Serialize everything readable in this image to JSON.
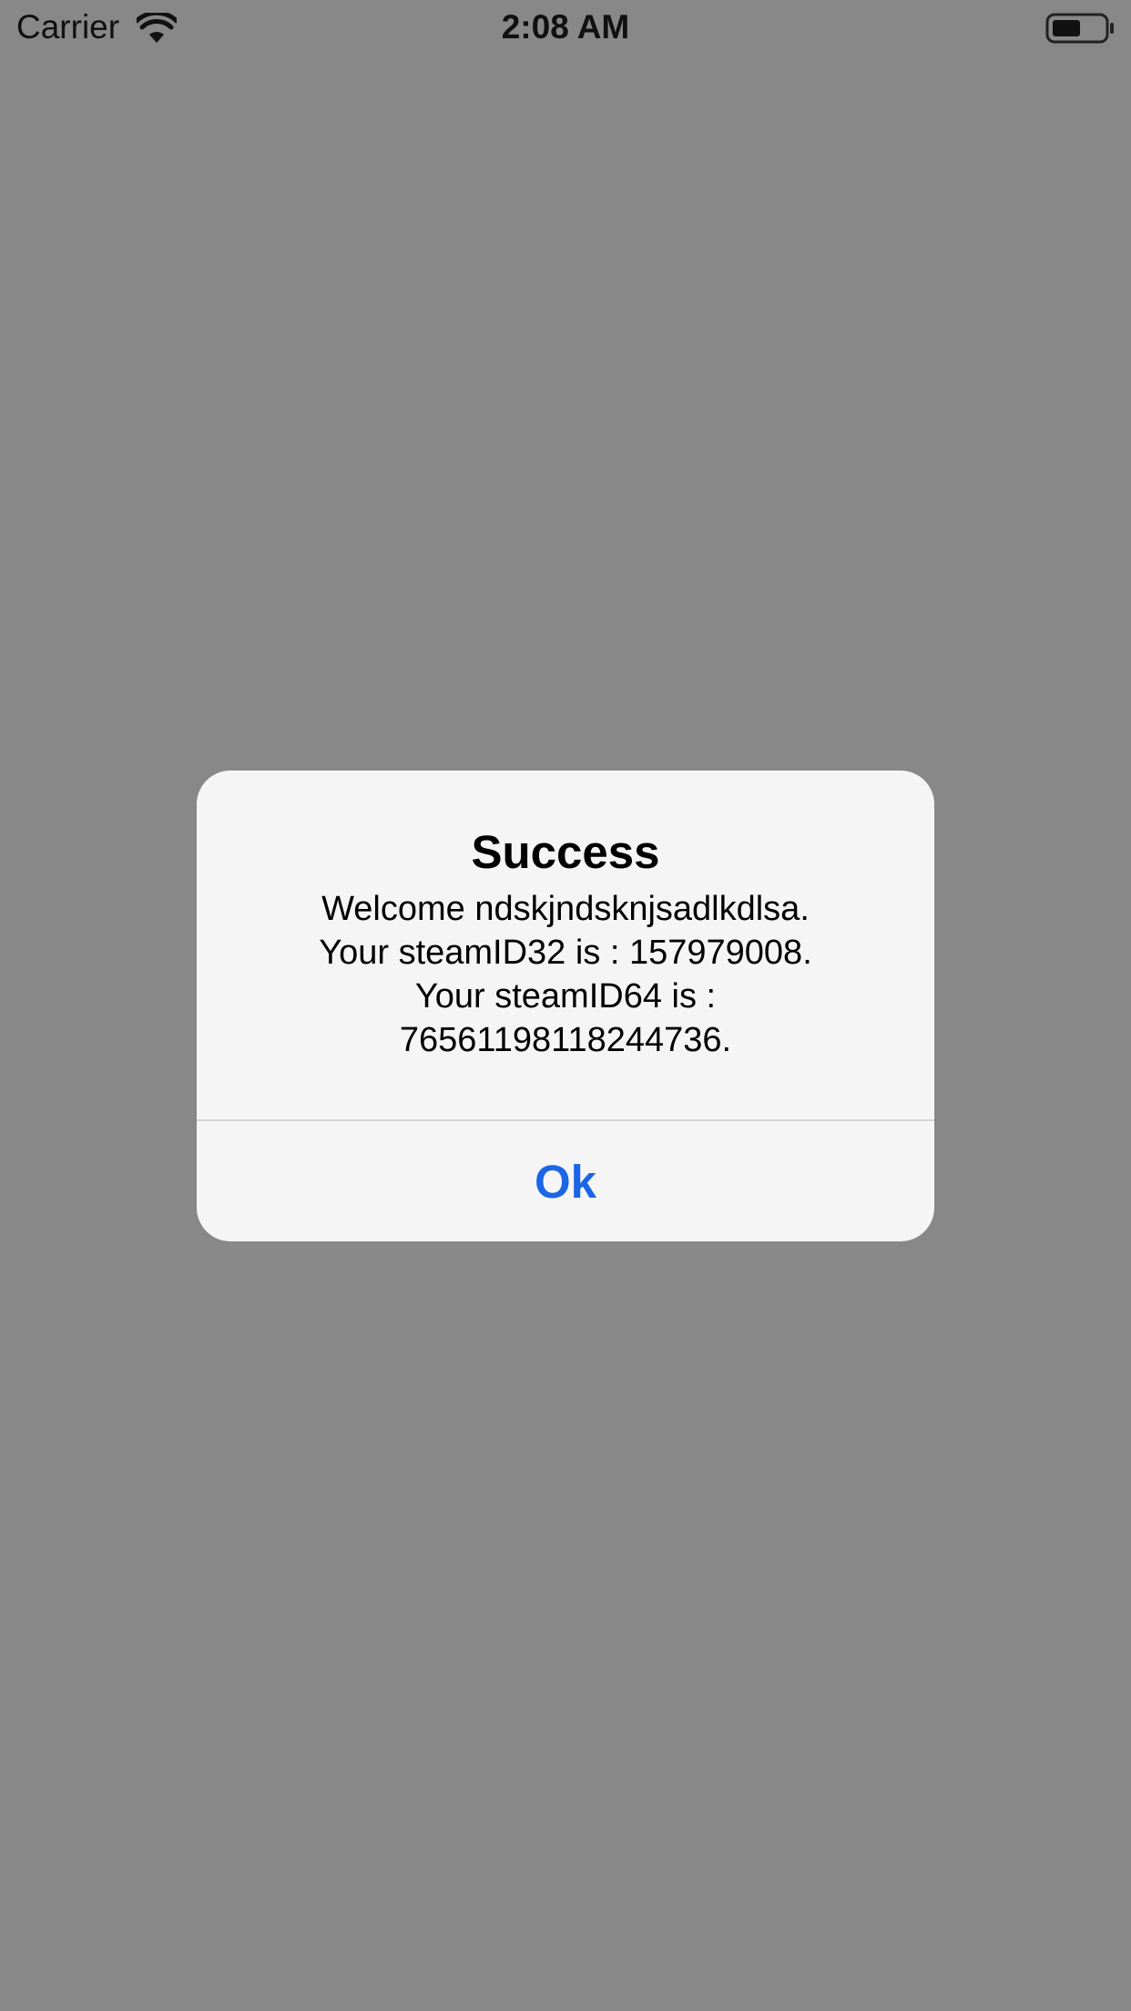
{
  "status_bar": {
    "carrier": "Carrier",
    "time": "2:08 AM",
    "wifi_icon": "wifi-icon",
    "battery_icon": "battery-icon"
  },
  "alert": {
    "title": "Success",
    "message": "Welcome ndskjndsknjsadlkdlsa.\nYour steamID32 is : 157979008.\nYour steamID64 is :\n76561198118244736.",
    "ok_label": "Ok"
  },
  "colors": {
    "backdrop": "#888888",
    "alert_background": "#f5f5f5",
    "button_text": "#1a66e6"
  }
}
